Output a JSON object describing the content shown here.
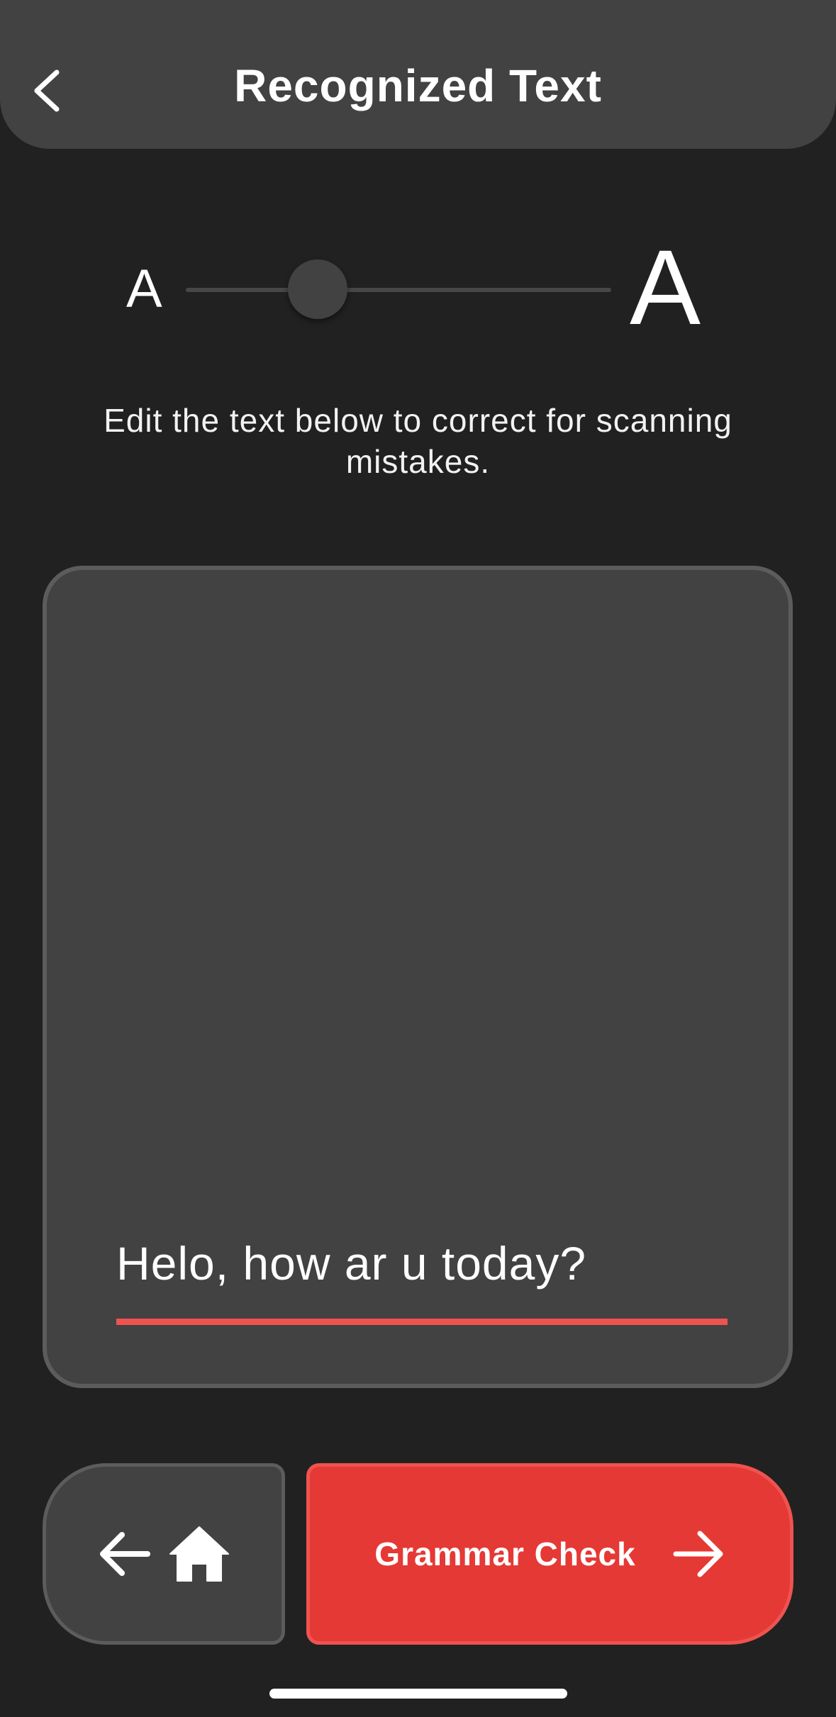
{
  "header": {
    "title": "Recognized Text",
    "back_icon": "chevron-left-icon"
  },
  "font_size_slider": {
    "small_label": "A",
    "large_label": "A",
    "value_fraction": 0.31
  },
  "instructions": "Edit the text below to correct for scanning mistakes.",
  "editor": {
    "value": "Helo, how ar u today?",
    "underline_color": "#ef5350"
  },
  "footer": {
    "home_button_icons": [
      "arrow-left-icon",
      "home-icon"
    ],
    "grammar_check_label": "Grammar Check",
    "grammar_check_icon": "arrow-right-icon",
    "accent_color": "#e53935"
  }
}
